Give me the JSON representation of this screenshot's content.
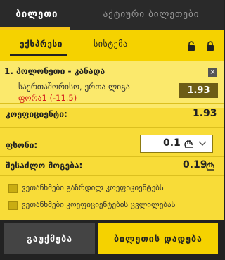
{
  "tabs": {
    "active": "ბილეთი",
    "other": "აქტიური ბილეთები"
  },
  "subtabs": {
    "express": "ექსპრესი",
    "system": "სისტემა"
  },
  "bet": {
    "number": "1.",
    "match": "პოლონეთი - კანადა",
    "league": "საერთაშორისო, ერთა ლიგა",
    "market": "ფორა1 (-11.5)",
    "odds": "1.93",
    "close_symbol": "×"
  },
  "summary": {
    "coef_label": "კოეფიციენტი:",
    "coef_value": "1.93",
    "stake_label": "ფსონი:",
    "stake_value": "0.1",
    "win_label": "შესაძლო მოგება:",
    "win_value": "0.19"
  },
  "options": {
    "opt1": "ვეთანხმები გაზრდილ კოეფიციენტებს",
    "opt2": "ვეთანხმები კოეფიციენტების ცვლილებას"
  },
  "buttons": {
    "clear": "გაუქმება",
    "place": "ბილეთის დადება"
  },
  "colors": {
    "accent": "#f5d200",
    "panel": "#f8dc38",
    "dark": "#222222",
    "market_red": "#d21a1a"
  },
  "icons": [
    "lock-open-icon",
    "lock-icon",
    "close-icon",
    "lari-currency-icon",
    "chevron-down-icon"
  ]
}
